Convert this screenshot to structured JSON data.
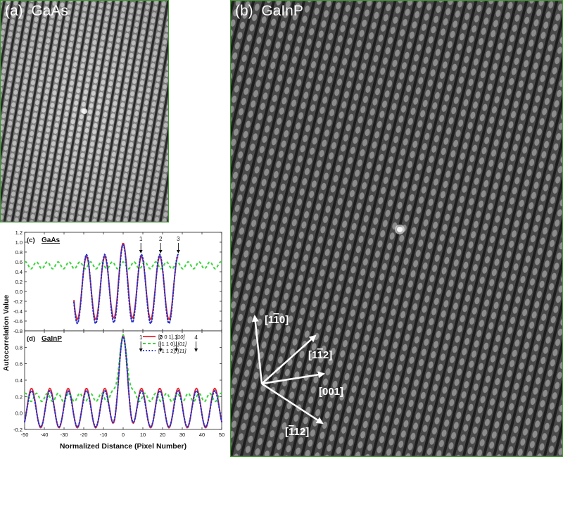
{
  "panel_a": {
    "label": "(a)  GaAs"
  },
  "panel_b": {
    "label": "(b)  GaInP",
    "directions": [
      {
        "label": "[1̅ ̅ ]"
      }
    ]
  },
  "direction_labels": {
    "d1": {
      "pre": "[1",
      "bar": "1",
      "post": "0]"
    },
    "d2": {
      "pre": "[1",
      "bar": "1",
      "post": "2]"
    },
    "d3": {
      "pre": "[001]",
      "bar": "",
      "post": ""
    },
    "d4": {
      "pre": "[",
      "bar": "1",
      "post": "12]"
    }
  },
  "chart_data": [
    {
      "type": "line",
      "panel_label": "(c)",
      "title": "GaAs",
      "ylabel": "Autocorrelation Value",
      "xlabel": "",
      "xlim": [
        -50,
        50
      ],
      "ylim": [
        -0.8,
        1.2
      ],
      "yticks": [
        "1.2",
        "1.0",
        "0.8",
        "0.6",
        "0.4",
        "0.2",
        "0.0",
        "-0.2",
        "-0.4",
        "-0.6",
        "-0.8"
      ],
      "x_ticks_labeled": false,
      "peak_markers": [
        {
          "x": 9,
          "label": "1"
        },
        {
          "x": 19,
          "label": "2"
        },
        {
          "x": 28,
          "label": "3"
        }
      ],
      "series": [
        {
          "name": "[0 0 1], [10]",
          "color": "#e8262b",
          "style": "solid",
          "x_range": [
            -25,
            28
          ],
          "period": 9.3,
          "center": 0.07,
          "amplitude": 0.64,
          "peak": 0.98
        },
        {
          "name": "[-1 1 0], [01]",
          "color": "#3ad63a",
          "style": "dashed",
          "x_range": [
            -50,
            50
          ],
          "period": 5.5,
          "center": 0.53,
          "amplitude": 0.07,
          "peak": 0.6
        },
        {
          "name": "[-1 1 2], [11]",
          "color": "#2330c8",
          "style": "dotted",
          "x_range": [
            -25,
            28
          ],
          "period": 9.3,
          "center": 0.05,
          "amplitude": 0.7,
          "peak": 0.95
        }
      ]
    },
    {
      "type": "line",
      "panel_label": "(d)",
      "title": "GaInP",
      "ylabel": "Autocorrelation Value",
      "xlabel": "Normalized Distance (Pixel Number)",
      "xlim": [
        -50,
        50
      ],
      "ylim": [
        -0.2,
        1.0
      ],
      "yticks": [
        "0.8",
        "0.6",
        "0.4",
        "0.2",
        "0.0",
        "-0.2"
      ],
      "xticks": [
        "-50",
        "-40",
        "-30",
        "-20",
        "-10",
        "0",
        "10",
        "20",
        "30",
        "40",
        "50"
      ],
      "peak_markers": [
        {
          "x": 9,
          "label": "1"
        },
        {
          "x": 19,
          "label": "2"
        },
        {
          "x": 27,
          "label": "3"
        },
        {
          "x": 37,
          "label": "4"
        }
      ],
      "legend": {
        "position": "top-right",
        "entries": [
          {
            "code": "[0 0 1],",
            "italic": "[10]",
            "color": "#e8262b",
            "style": "solid"
          },
          {
            "code": "[-1 1 0],",
            "italic": "[01]",
            "color": "#3ad63a",
            "style": "dashed"
          },
          {
            "code": "[-1 1 2],",
            "italic": "[11]",
            "color": "#2330c8",
            "style": "dotted"
          }
        ]
      },
      "series": [
        {
          "name": "[0 0 1], [10]",
          "color": "#e8262b",
          "style": "solid",
          "x_range": [
            -50,
            50
          ],
          "period": 9.3,
          "center": 0.06,
          "amplitude": 0.24,
          "peak": 0.95
        },
        {
          "name": "[-1 1 0], [01]",
          "color": "#3ad63a",
          "style": "dashed",
          "x_range": [
            -50,
            50
          ],
          "period": 5.5,
          "center": 0.19,
          "amplitude": 0.05,
          "peak": 0.95
        },
        {
          "name": "[-1 1 2], [11]",
          "color": "#2330c8",
          "style": "dotted",
          "x_range": [
            -50,
            50
          ],
          "period": 9.3,
          "center": 0.05,
          "amplitude": 0.22,
          "peak": 0.93
        }
      ]
    }
  ]
}
